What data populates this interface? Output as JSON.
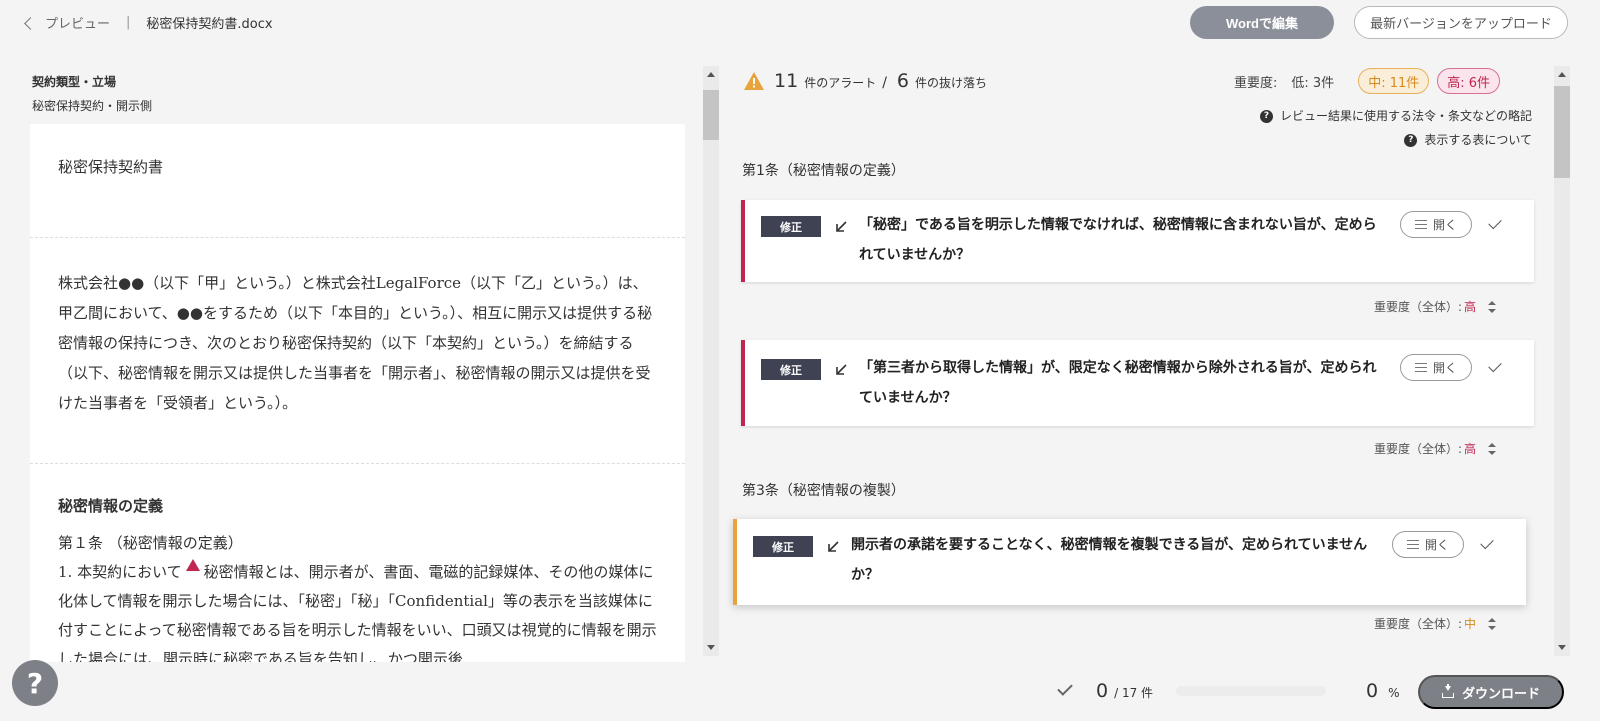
{
  "header": {
    "back_label": "プレビュー",
    "separator": "|",
    "filename": "秘密保持契約書.docx",
    "word_edit_label": "Wordで編集",
    "upload_label": "最新バージョンをアップロード"
  },
  "contract": {
    "type_heading": "契約類型・立場",
    "type_value": "秘密保持契約・開示側"
  },
  "document": {
    "title": "秘密保持契約書",
    "preamble": "株式会社●●（以下「甲」という。）と株式会社LegalForce（以下「乙」という。）は、甲乙間において、●●をするため（以下「本目的」という。）、相互に開示又は提供する秘密情報の保持につき、次のとおり秘密保持契約（以下「本契約」という。）を締結する（以下、秘密情報を開示又は提供した当事者を「開示者」、秘密情報の開示又は提供を受けた当事者を「受領者」という。）。",
    "section_heading": "秘密情報の定義",
    "article_heading": "第１条 （秘密情報の定義）",
    "clause_start": "1. 本契約において",
    "clause_rest": "秘密情報とは、開示者が、書面、電磁的記録媒体、その他の媒体に化体して情報を開示した場合には、「秘密」「秘」「Confidential」等の表示を当該媒体に付すことによって秘密情報である旨を明示した情報をいい、口頭又は視覚的に情報を開示した場合には、開示時に秘密である旨を告知し、かつ開示後"
  },
  "summary": {
    "alert_count": "11",
    "alert_label": "件のアラート",
    "slash": "/",
    "missing_count": "6",
    "missing_label": "件の抜け落ち"
  },
  "severity": {
    "label": "重要度:",
    "low": "低: 3件",
    "mid": "中: 11件",
    "high": "高: 6件"
  },
  "help_links": {
    "abbreviations": "レビュー結果に使用する法令・条文などの略記",
    "table_info": "表示する表について"
  },
  "articles": [
    {
      "title": "第1条（秘密情報の定義）"
    },
    {
      "title": "第3条（秘密情報の複製）"
    }
  ],
  "alerts": [
    {
      "tag": "修正",
      "text": "「秘密」である旨を明示した情報でなければ、秘密情報に含まれない旨が、定められていませんか？",
      "open_label": "開く",
      "overall_label": "重要度（全体）:",
      "overall_value": "高"
    },
    {
      "tag": "修正",
      "text": "「第三者から取得した情報」が、限定なく秘密情報から除外される旨が、定められていませんか？",
      "open_label": "開く",
      "overall_label": "重要度（全体）:",
      "overall_value": "高"
    },
    {
      "tag": "修正",
      "text": "開示者の承諾を要することなく、秘密情報を複製できる旨が、定められていませんか？",
      "open_label": "開く",
      "overall_label": "重要度（全体）:",
      "overall_value": "中"
    }
  ],
  "progress": {
    "done": "0",
    "total_label": "/ 17 件",
    "fraction": 0,
    "percent": "0",
    "percent_sign": "%",
    "download_label": "ダウンロード"
  },
  "colors": {
    "high": "#c0264f",
    "mid": "#e8a33c",
    "warn_icon": "#e8a33c",
    "button_gray": "#7d8087"
  },
  "help_button": "?"
}
